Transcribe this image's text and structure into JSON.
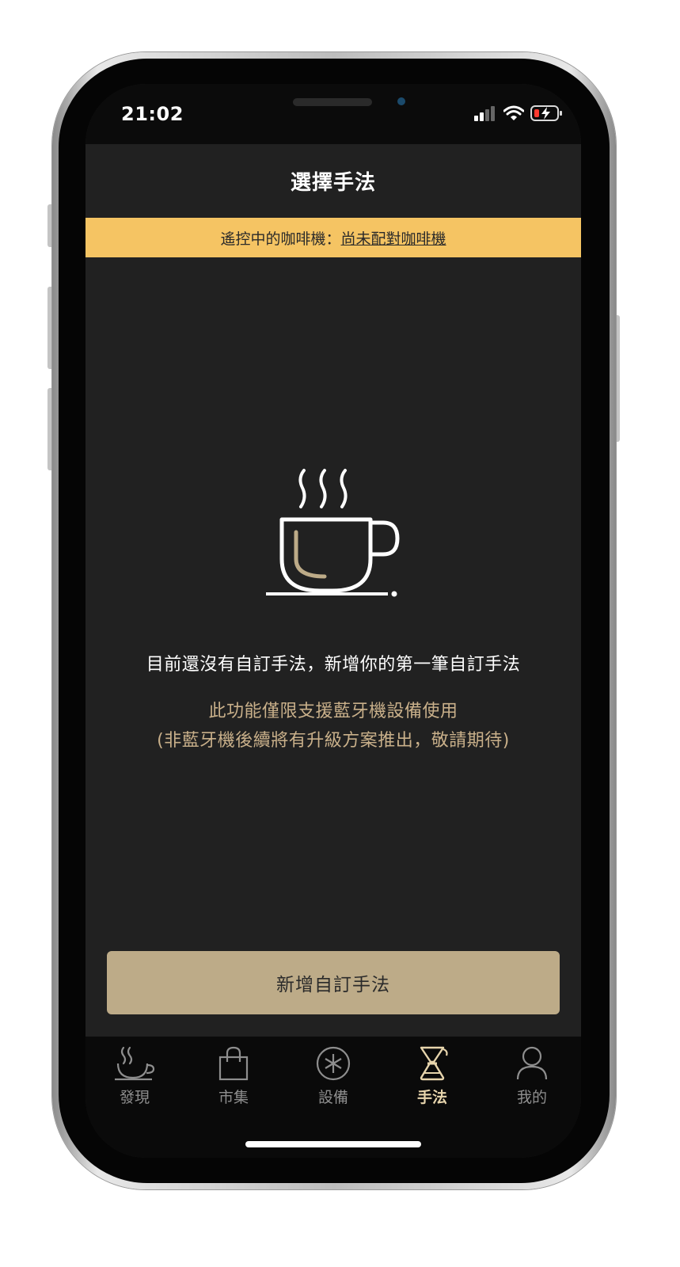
{
  "status_bar": {
    "time": "21:02"
  },
  "header": {
    "title": "選擇手法"
  },
  "banner": {
    "label": "遙控中的咖啡機：",
    "link": "尚未配對咖啡機"
  },
  "empty_state": {
    "icon": "coffee-cup-icon",
    "title": "目前還沒有自訂手法，新增你的第一筆自訂手法",
    "note_line1": "此功能僅限支援藍牙機設備使用",
    "note_line2": "(非藍牙機後續將有升級方案推出，敬請期待)"
  },
  "actions": {
    "add_label": "新增自訂手法"
  },
  "tabs": [
    {
      "label": "發現",
      "icon": "steaming-cup-icon",
      "active": false
    },
    {
      "label": "市集",
      "icon": "shopping-bag-icon",
      "active": false
    },
    {
      "label": "設備",
      "icon": "device-icon",
      "active": false
    },
    {
      "label": "手法",
      "icon": "chemex-icon",
      "active": true
    },
    {
      "label": "我的",
      "icon": "user-icon",
      "active": false
    }
  ],
  "colors": {
    "accent": "#f5c463",
    "button": "#bdab88",
    "note_text": "#c9b08a",
    "background": "#212121",
    "tab_active": "#e6d4ac"
  }
}
